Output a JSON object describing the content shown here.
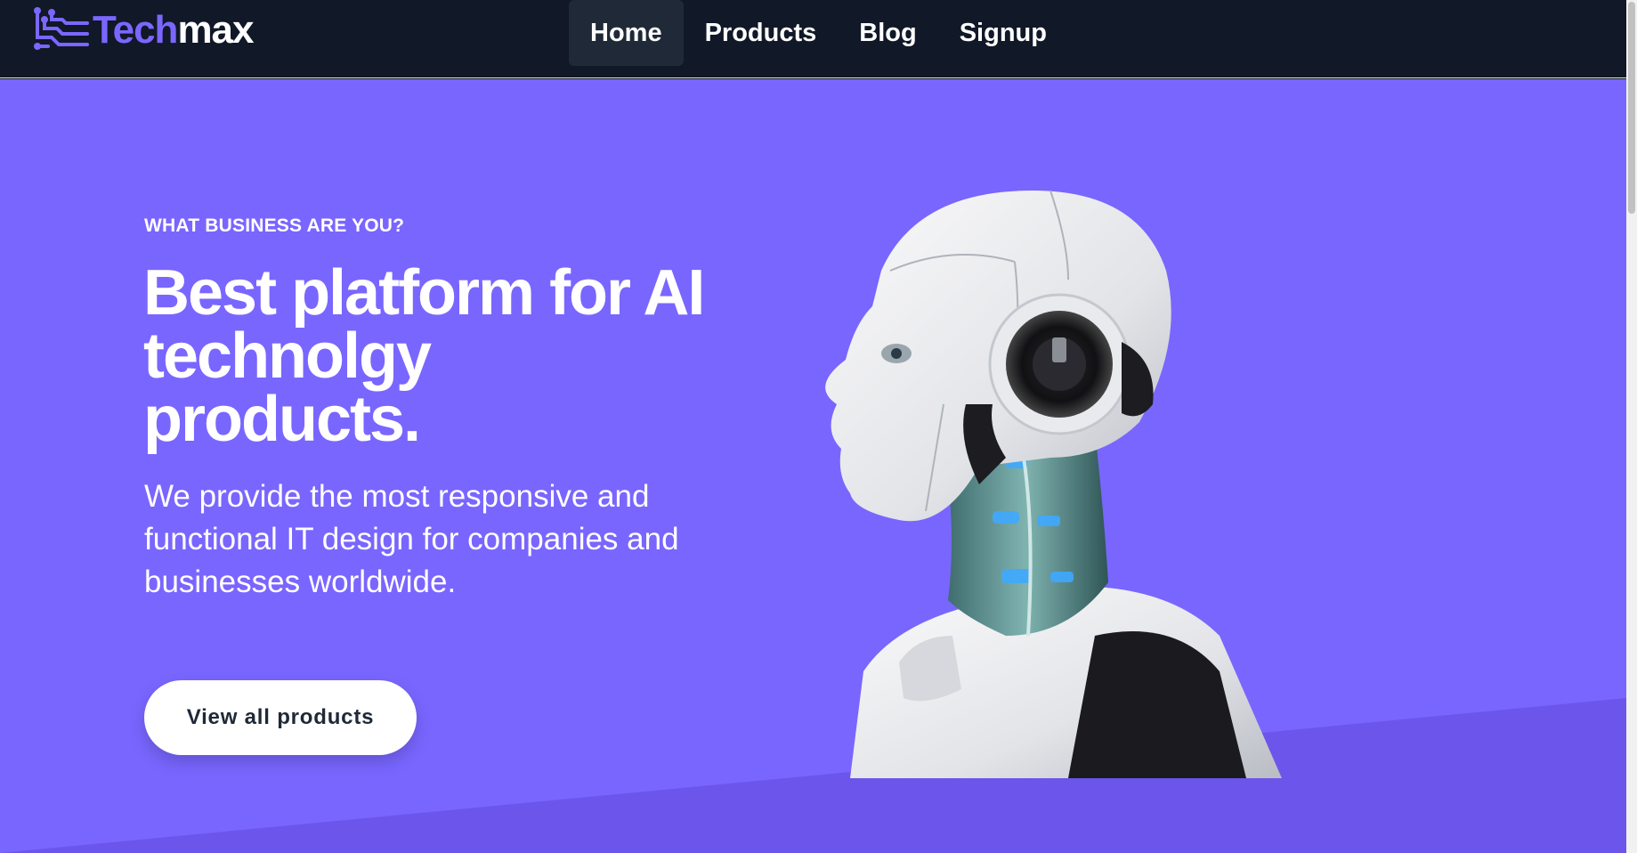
{
  "brand": {
    "name_part1": "Tech",
    "name_part2": "max",
    "icon": "circuit-icon",
    "accent_color": "#7b67ff"
  },
  "nav": {
    "items": [
      {
        "label": "Home",
        "active": true
      },
      {
        "label": "Products",
        "active": false
      },
      {
        "label": "Blog",
        "active": false
      },
      {
        "label": "Signup",
        "active": false
      }
    ]
  },
  "hero": {
    "eyebrow": "WHAT BUSINESS ARE YOU?",
    "headline": "Best platform for AI technolgy products.",
    "description": "We provide the most responsive and functional IT design for companies and businesses worldwide.",
    "cta_label": "View all products",
    "image": "robot-head-illustration",
    "background_color": "#7966ff"
  },
  "colors": {
    "navbar": "#111827",
    "nav_active": "#1f2937",
    "text_light": "#ffffff"
  }
}
